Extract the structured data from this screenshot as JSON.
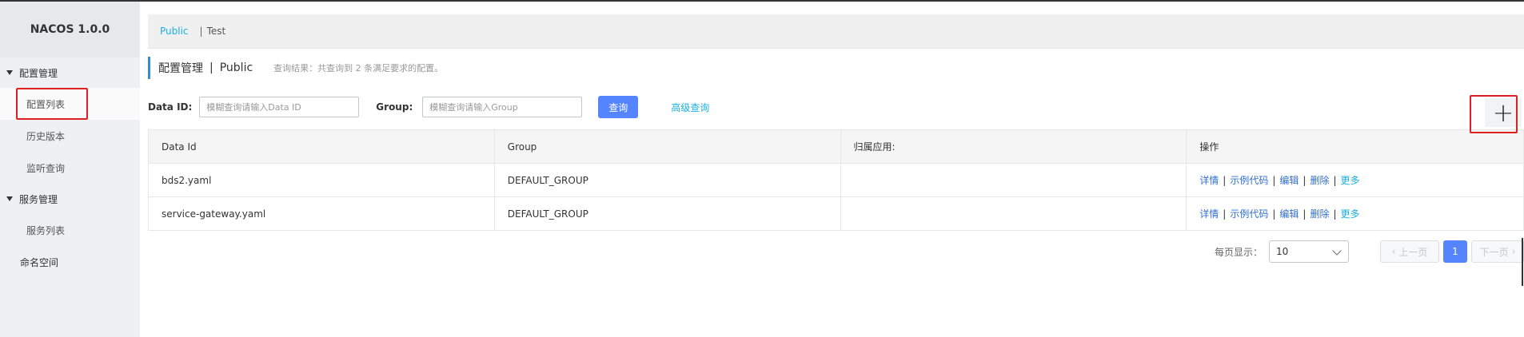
{
  "app": {
    "title": "NACOS 1.0.0"
  },
  "sidebar": {
    "groups": [
      {
        "label": "配置管理",
        "items": [
          {
            "label": "配置列表"
          },
          {
            "label": "历史版本"
          },
          {
            "label": "监听查询"
          }
        ]
      },
      {
        "label": "服务管理",
        "items": [
          {
            "label": "服务列表"
          }
        ]
      }
    ],
    "namespace_label": "命名空间"
  },
  "tabs": {
    "public": "Public",
    "separator": "|",
    "test": "Test"
  },
  "page": {
    "title": "配置管理",
    "separator": "|",
    "namespace": "Public",
    "result_text": "查询结果：共查询到 2 条满足要求的配置。"
  },
  "search": {
    "data_id_label": "Data ID:",
    "data_id_placeholder": "模糊查询请输入Data ID",
    "group_label": "Group:",
    "group_placeholder": "模糊查询请输入Group",
    "query_button": "查询",
    "advanced_link": "高级查询",
    "add_button": "+"
  },
  "table": {
    "columns": [
      "Data Id",
      "Group",
      "归属应用:",
      "操作"
    ],
    "rows": [
      {
        "data_id": "bds2.yaml",
        "group": "DEFAULT_GROUP",
        "app": ""
      },
      {
        "data_id": "service-gateway.yaml",
        "group": "DEFAULT_GROUP",
        "app": ""
      }
    ],
    "actions": {
      "detail": "详情",
      "sample": "示例代码",
      "edit": "编辑",
      "delete": "删除",
      "more": "更多",
      "sep": "|"
    }
  },
  "pager": {
    "page_size_label": "每页显示：",
    "page_size": "10",
    "prev": "上一页",
    "next": "下一页",
    "current": "1"
  },
  "colors": {
    "accent": "#5584ff",
    "link": "#1ab0de",
    "highlight": "#e02020"
  }
}
